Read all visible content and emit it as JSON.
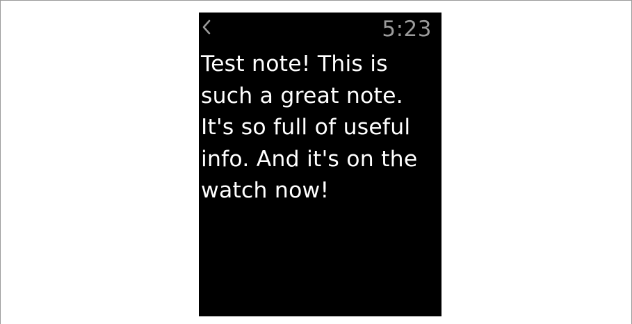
{
  "watch": {
    "status_bar": {
      "back_icon": "chevron-left-icon",
      "time": "5:23"
    },
    "note": {
      "text": "Test note! This is\nsuch a great note.\nIt's so full of useful\ninfo. And it's on the\nwatch now!"
    },
    "colors": {
      "screen_background": "#000000",
      "note_text": "#ffffff",
      "time_text": "#9b9b9b",
      "back_icon": "#9b9b9b",
      "page_background": "#ffffff"
    }
  }
}
